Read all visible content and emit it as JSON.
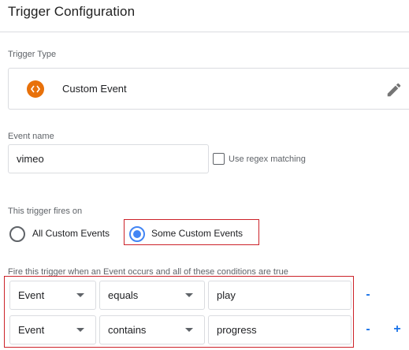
{
  "header": {
    "title": "Trigger Configuration"
  },
  "trigger_type": {
    "label": "Trigger Type",
    "name": "Custom Event",
    "icon": "code-brackets-icon",
    "icon_color": "#e8710a",
    "edit_icon": "pencil-icon"
  },
  "event_name": {
    "label": "Event name",
    "value": "vimeo",
    "regex_label": "Use regex matching",
    "regex_checked": false
  },
  "fires_on": {
    "label": "This trigger fires on",
    "options": [
      {
        "label": "All Custom Events",
        "selected": false
      },
      {
        "label": "Some Custom Events",
        "selected": true
      }
    ]
  },
  "conditions": {
    "label": "Fire this trigger when an Event occurs and all of these conditions are true",
    "rows": [
      {
        "variable": "Event",
        "operator": "equals",
        "value": "play",
        "remove": "-",
        "add": ""
      },
      {
        "variable": "Event",
        "operator": "contains",
        "value": "progress",
        "remove": "-",
        "add": "+"
      }
    ]
  },
  "colors": {
    "accent": "#4285f4",
    "highlight": "#cc2229",
    "link_button": "#1a73e8"
  }
}
